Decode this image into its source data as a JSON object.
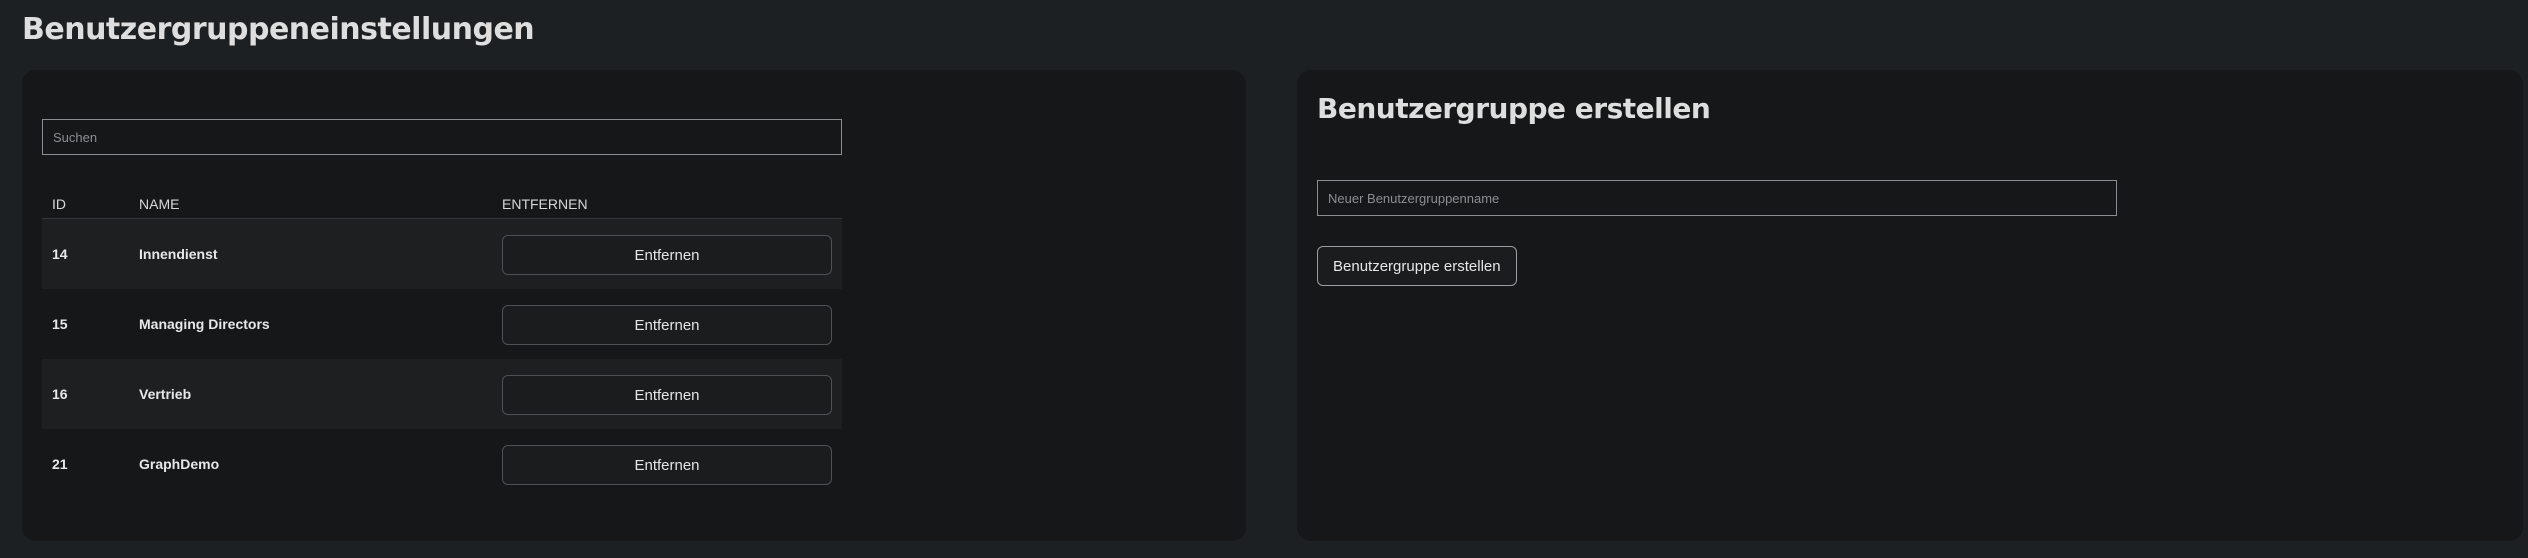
{
  "page": {
    "title": "Benutzergruppeneinstellungen"
  },
  "list_panel": {
    "search_placeholder": "Suchen",
    "columns": {
      "id": "ID",
      "name": "NAME",
      "remove": "ENTFERNEN"
    },
    "rows": [
      {
        "id": "14",
        "name": "Innendienst",
        "remove_label": "Entfernen"
      },
      {
        "id": "15",
        "name": "Managing Directors",
        "remove_label": "Entfernen"
      },
      {
        "id": "16",
        "name": "Vertrieb",
        "remove_label": "Entfernen"
      },
      {
        "id": "21",
        "name": "GraphDemo",
        "remove_label": "Entfernen"
      }
    ]
  },
  "create_panel": {
    "title": "Benutzergruppe erstellen",
    "name_placeholder": "Neuer Benutzergruppenname",
    "submit_label": "Benutzergruppe erstellen"
  },
  "colors": {
    "page_background": "#1c2022",
    "panel_background": "#151718",
    "striped_row": "#1d1f21",
    "text": "#e6e6e6"
  }
}
